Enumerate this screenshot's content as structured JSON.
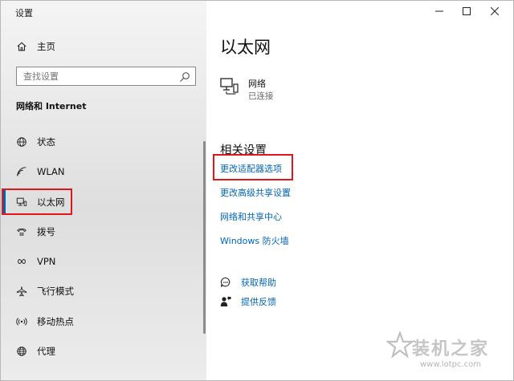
{
  "window": {
    "title": "设置"
  },
  "sidebar": {
    "home": {
      "label": "主页",
      "icon": "home-icon"
    },
    "search": {
      "placeholder": "查找设置",
      "icon": "search-icon"
    },
    "section_title": "网络和 Internet",
    "items": [
      {
        "label": "状态",
        "icon": "globe-status-icon"
      },
      {
        "label": "WLAN",
        "icon": "wifi-icon"
      },
      {
        "label": "以太网",
        "icon": "ethernet-icon",
        "selected": true
      },
      {
        "label": "拨号",
        "icon": "dialup-phone-icon"
      },
      {
        "label": "VPN",
        "icon": "vpn-icon"
      },
      {
        "label": "飞行模式",
        "icon": "airplane-icon"
      },
      {
        "label": "移动热点",
        "icon": "hotspot-icon"
      },
      {
        "label": "代理",
        "icon": "globe-proxy-icon"
      }
    ]
  },
  "main": {
    "title": "以太网",
    "network": {
      "name": "网络",
      "status": "已连接",
      "icon": "network-computer-icon"
    },
    "related": {
      "title": "相关设置",
      "links": [
        {
          "label": "更改适配器选项",
          "highlighted": true
        },
        {
          "label": "更改高级共享设置"
        },
        {
          "label": "网络和共享中心"
        },
        {
          "label": "Windows 防火墙"
        }
      ]
    },
    "help": [
      {
        "label": "获取帮助",
        "icon": "help-chat-icon"
      },
      {
        "label": "提供反馈",
        "icon": "feedback-person-icon"
      }
    ]
  },
  "watermark": {
    "text": "装机之家",
    "url": "www.lotpc.com"
  },
  "colors": {
    "accent": "#0063b1",
    "link": "#0066b4",
    "highlight_box": "#e0161b"
  }
}
